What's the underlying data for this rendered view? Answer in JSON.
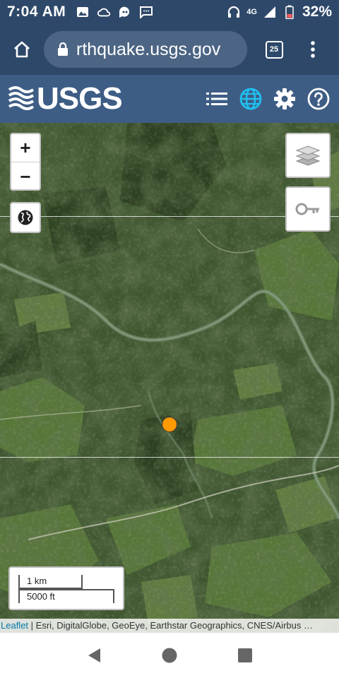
{
  "status_bar": {
    "time": "7:04 AM",
    "network": "4G",
    "battery": "32%"
  },
  "browser": {
    "url": "rthquake.usgs.gov",
    "tab_count": "25"
  },
  "header": {
    "logo_text": "USGS",
    "icons": [
      "list-icon",
      "globe-icon",
      "gear-icon",
      "help-icon"
    ],
    "accent_color": "#1fc0f0"
  },
  "map": {
    "zoom_in": "+",
    "zoom_out": "−",
    "scale_metric": "1 km",
    "scale_imperial": "5000 ft",
    "attribution_link": "Leaflet",
    "attribution_text": " | Esri, DigitalGlobe, GeoEye, Earthstar Geographics, CNES/Airbus …",
    "marker_color": "#ff9900"
  }
}
